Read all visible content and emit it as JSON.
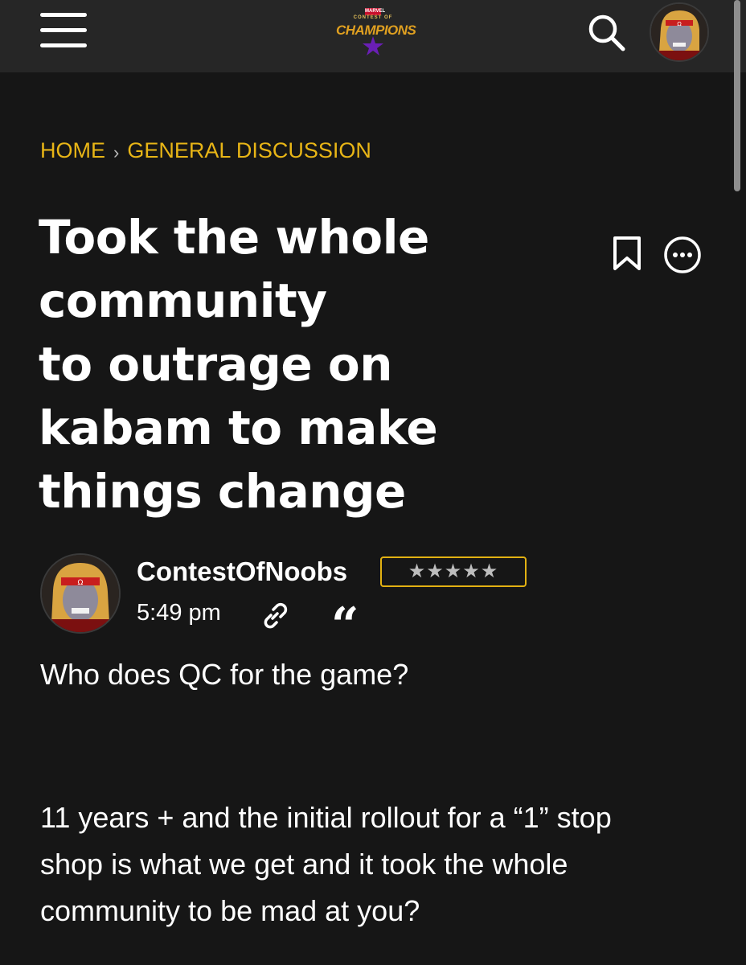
{
  "header": {
    "logo": {
      "brand": "MARVEL",
      "line1": "CONTEST OF",
      "line2": "CHAMPIONS"
    },
    "icons": {
      "menu": "hamburger-icon",
      "search": "search-icon",
      "profile": "avatar"
    }
  },
  "breadcrumb": {
    "items": [
      "HOME",
      "GENERAL DISCUSSION"
    ],
    "separator": "›"
  },
  "post": {
    "title_lines": [
      "Took the whole",
      "community",
      "to outrage on",
      "kabam to make",
      "things change"
    ],
    "author": "ContestOfNoobs",
    "rank_stars": "★★★★★",
    "time": "5:49 pm",
    "quote_glyph": "“",
    "body": {
      "question": "Who does QC for the game?",
      "paragraph": "11 years + and the initial rollout for a “1” stop shop is what we get and it took the whole community to be mad at you?"
    }
  },
  "colors": {
    "background": "#161616",
    "header_bg": "#262626",
    "accent": "#e8b516",
    "text": "#ffffff"
  }
}
